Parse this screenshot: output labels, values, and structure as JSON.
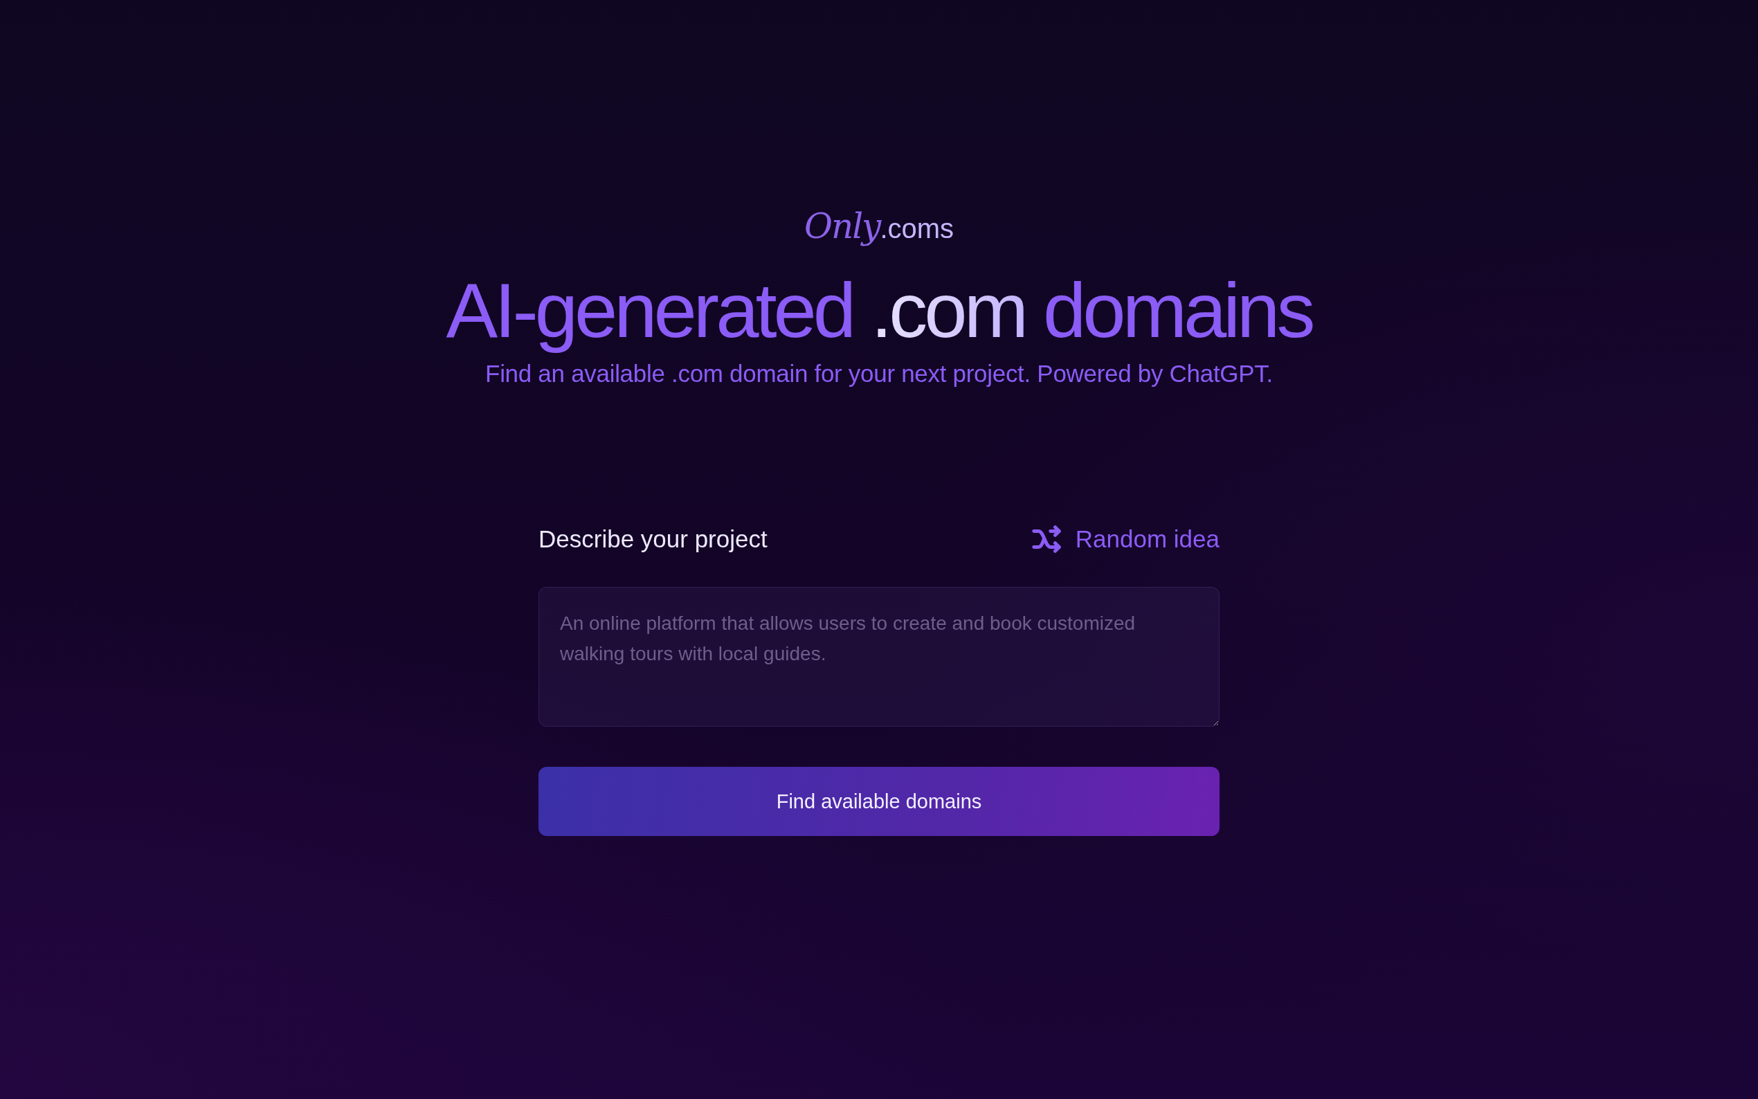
{
  "logo": {
    "script": "Only",
    "text": ".coms"
  },
  "headline": [
    {
      "text": "AI-generated ",
      "kind": "plain"
    },
    {
      "text": ".com",
      "kind": "highlight"
    },
    {
      "text": " domains",
      "kind": "plain"
    }
  ],
  "subtitle": "Find an available .com domain for your next project. Powered by ChatGPT.",
  "form": {
    "label": "Describe your project",
    "random_button": "Random idea",
    "placeholder": "An online platform that allows users to create and book customized walking tours with local guides.",
    "submit_button": "Find available domains"
  }
}
